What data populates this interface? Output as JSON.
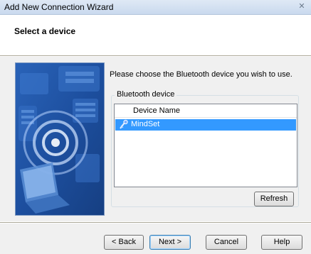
{
  "window": {
    "title": "Add New Connection Wizard",
    "close_glyph": "✕"
  },
  "header": {
    "heading": "Select a device"
  },
  "main": {
    "prompt": "Please choose the Bluetooth device you wish to use.",
    "group_label": "Bluetooth device",
    "list": {
      "column_header": "Device Name",
      "rows": [
        {
          "name": "MindSet",
          "icon": "bluetooth-device-icon",
          "selected": true
        }
      ]
    },
    "refresh_label": "Refresh"
  },
  "footer": {
    "back_label": "< Back",
    "next_label": "Next >",
    "cancel_label": "Cancel",
    "help_label": "Help"
  },
  "colors": {
    "selection": "#3399ff",
    "body_bg": "#f0f0f0",
    "art_blue": "#1f4f9e"
  }
}
